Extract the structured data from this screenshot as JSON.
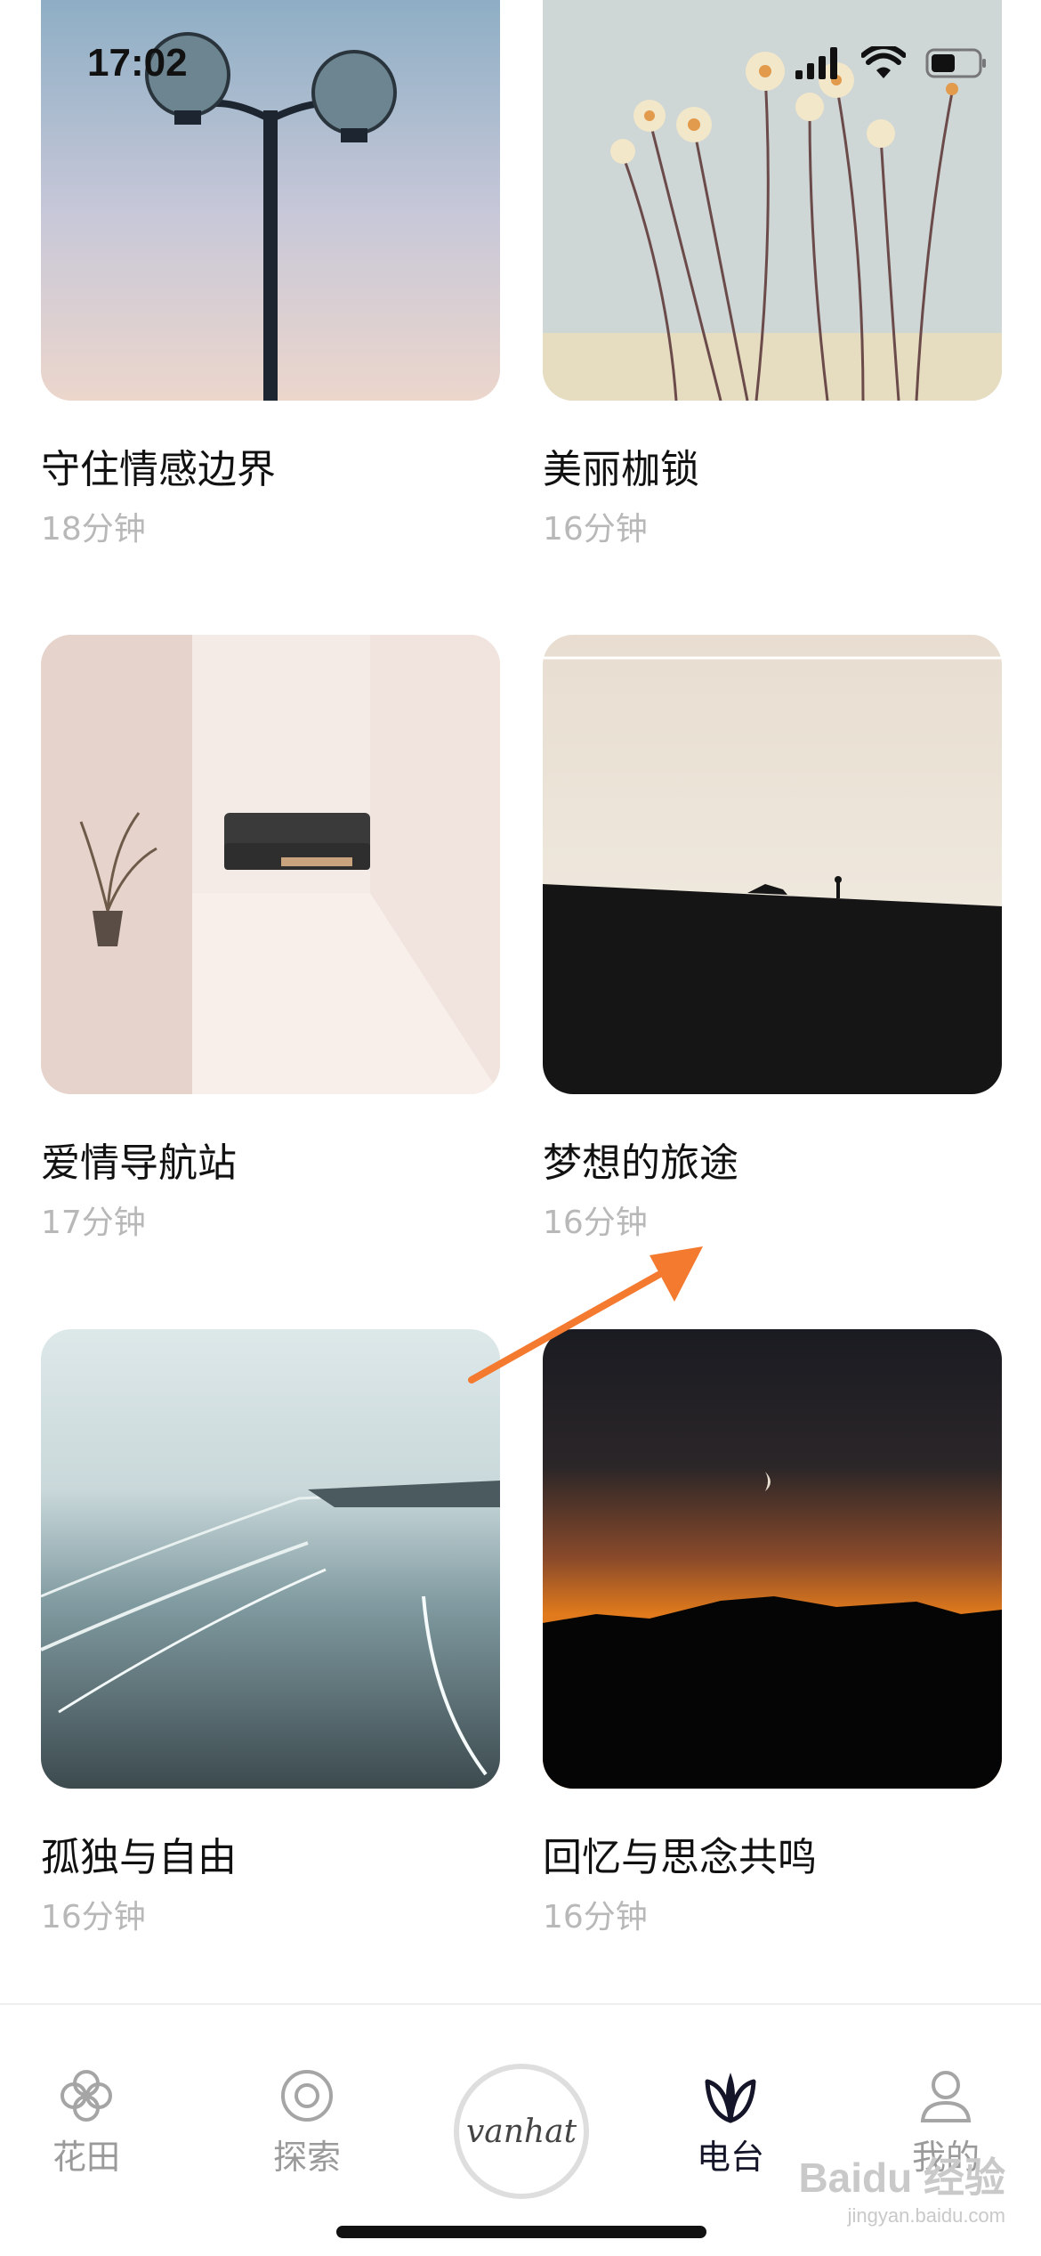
{
  "status_bar": {
    "time": "17:02"
  },
  "cards": [
    {
      "title": "守住情感边界",
      "duration": "18分钟"
    },
    {
      "title": "美丽枷锁",
      "duration": "16分钟"
    },
    {
      "title": "爱情导航站",
      "duration": "17分钟"
    },
    {
      "title": "梦想的旅途",
      "duration": "16分钟"
    },
    {
      "title": "孤独与自由",
      "duration": "16分钟"
    },
    {
      "title": "回忆与思念共鸣",
      "duration": "16分钟"
    }
  ],
  "tabbar": {
    "tabs": [
      {
        "label": "花田",
        "icon": "flower-field-icon"
      },
      {
        "label": "探索",
        "icon": "explore-icon"
      },
      {
        "label": "vanhat",
        "icon": "vanhat-logo"
      },
      {
        "label": "电台",
        "icon": "leaf-icon"
      },
      {
        "label": "我的",
        "icon": "profile-icon"
      }
    ],
    "active_tab": "电台"
  },
  "watermark": {
    "logo": "Baidu 经验",
    "sub": "jingyan.baidu.com"
  },
  "colors": {
    "active_tab": "#15152a",
    "inactive_tab": "#9a9a9a",
    "arrow": "#f47a30",
    "duration_text": "#b8b8b8"
  }
}
